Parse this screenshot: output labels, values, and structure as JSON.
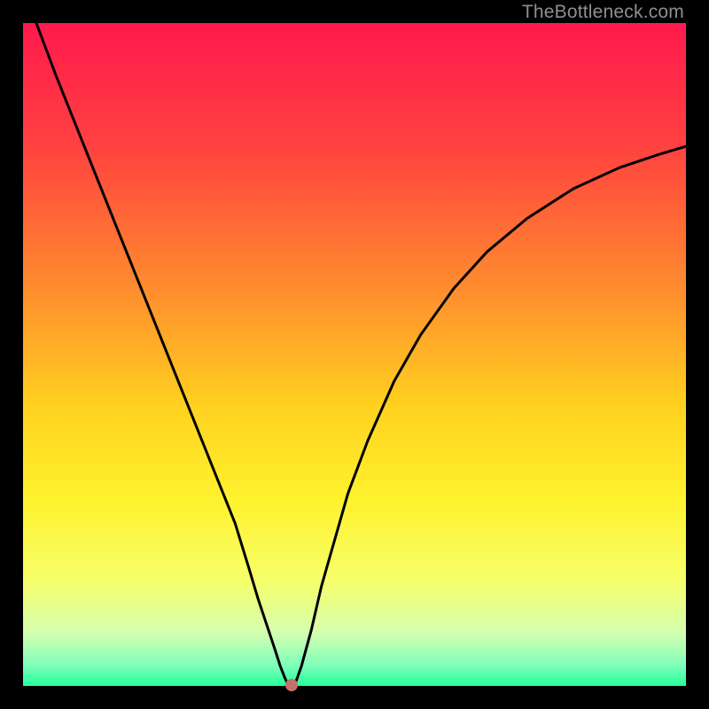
{
  "watermark": "TheBottleneck.com",
  "chart_data": {
    "type": "line",
    "title": "",
    "xlabel": "",
    "ylabel": "",
    "xlim": [
      0,
      100
    ],
    "ylim": [
      0,
      100
    ],
    "background_gradient": {
      "stops": [
        {
          "offset": 0.0,
          "color": "#ff1a4d"
        },
        {
          "offset": 0.18,
          "color": "#ff4040"
        },
        {
          "offset": 0.4,
          "color": "#ff8c2e"
        },
        {
          "offset": 0.58,
          "color": "#ffd21f"
        },
        {
          "offset": 0.72,
          "color": "#fff22e"
        },
        {
          "offset": 0.84,
          "color": "#f6ff6a"
        },
        {
          "offset": 0.92,
          "color": "#d4ffb0"
        },
        {
          "offset": 0.97,
          "color": "#7dffba"
        },
        {
          "offset": 1.0,
          "color": "#22ff99"
        }
      ]
    },
    "series": [
      {
        "name": "bottleneck-curve",
        "color": "#000000",
        "x": [
          2,
          5,
          8,
          11,
          14,
          17,
          20,
          23,
          26,
          29,
          32,
          34,
          35.5,
          37,
          38,
          38.8,
          39.5,
          40,
          41,
          42,
          43.5,
          45,
          47,
          49,
          52,
          56,
          60,
          65,
          70,
          76,
          83,
          90,
          96,
          100
        ],
        "y": [
          100,
          92,
          84.5,
          77,
          69.5,
          62,
          54.5,
          47,
          39.5,
          32,
          24.5,
          18,
          13,
          8.5,
          5.5,
          3.0,
          1.2,
          0.2,
          0.2,
          3.0,
          8.5,
          15,
          22,
          29,
          37,
          46,
          53,
          60,
          65.5,
          70.5,
          75,
          78.2,
          80.2,
          81.4
        ]
      }
    ],
    "minimum_point": {
      "x": 40.5,
      "y": 0.2,
      "color": "#c76f6a"
    }
  }
}
